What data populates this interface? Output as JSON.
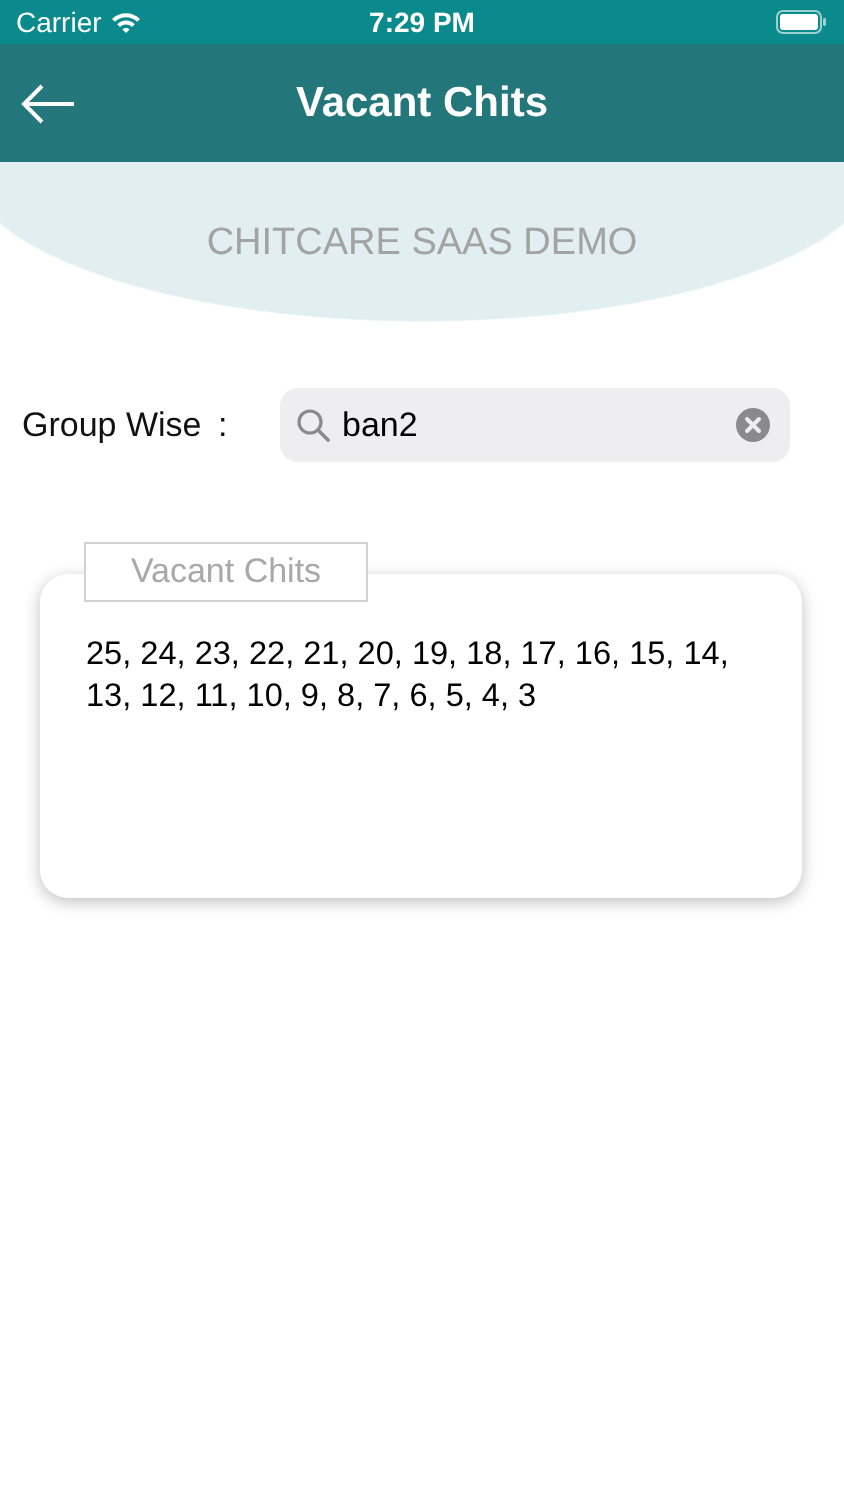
{
  "status_bar": {
    "carrier": "Carrier",
    "time": "7:29 PM"
  },
  "nav_bar": {
    "title": "Vacant Chits"
  },
  "subtitle": "CHITCARE SAAS DEMO",
  "filter": {
    "label": "Group Wise",
    "separator": ":",
    "search": {
      "value": "ban2"
    }
  },
  "card": {
    "legend": "Vacant Chits",
    "numbers": "25, 24, 23, 22, 21, 20, 19, 18, 17, 16, 15, 14, 13, 12, 11, 10, 9, 8, 7, 6, 5, 4, 3"
  }
}
